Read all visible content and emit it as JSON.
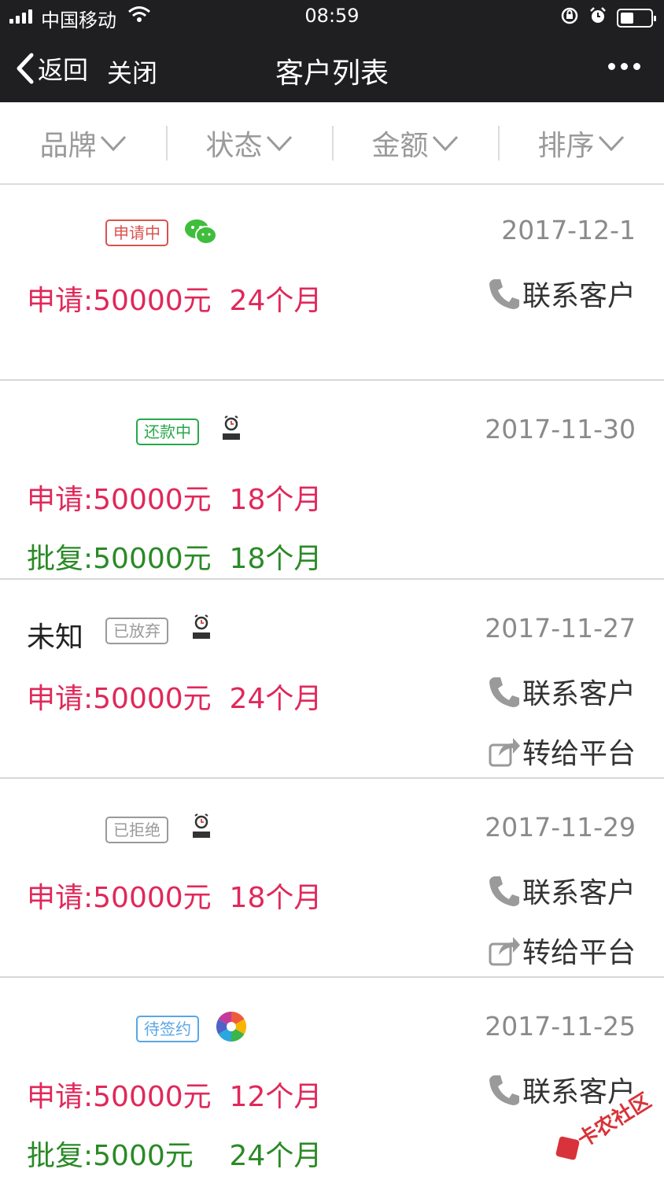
{
  "status_bar": {
    "carrier": "中国移动",
    "time": "08:59"
  },
  "nav": {
    "back_label": "返回",
    "close_label": "关闭",
    "title": "客户列表"
  },
  "filters": [
    {
      "label": "品牌"
    },
    {
      "label": "状态"
    },
    {
      "label": "金额"
    },
    {
      "label": "排序"
    }
  ],
  "customers": [
    {
      "name": "",
      "status": "申请中",
      "source_icon": "wechat-icon",
      "date": "2017-12-1",
      "apply_text": "申请:50000元  24个月",
      "approve_text": "",
      "contact_label": "联系客户",
      "transfer_label": ""
    },
    {
      "name": "",
      "status": "还款中",
      "source_icon": "alarm-app-icon",
      "date": "2017-11-30",
      "apply_text": "申请:50000元  18个月",
      "approve_text": "批复:50000元  18个月",
      "contact_label": "",
      "transfer_label": ""
    },
    {
      "name": "未知",
      "status": "已放弃",
      "source_icon": "alarm-app-icon",
      "date": "2017-11-27",
      "apply_text": "申请:50000元  24个月",
      "approve_text": "",
      "contact_label": "联系客户",
      "transfer_label": "转给平台"
    },
    {
      "name": "",
      "status": "已拒绝",
      "source_icon": "alarm-app-icon",
      "date": "2017-11-29",
      "apply_text": "申请:50000元  18个月",
      "approve_text": "",
      "contact_label": "联系客户",
      "transfer_label": "转给平台"
    },
    {
      "name": "",
      "status": "待签约",
      "source_icon": "color-wheel-icon",
      "date": "2017-11-25",
      "apply_text": "申请:50000元  12个月",
      "approve_text": "批复:5000元    24个月",
      "contact_label": "联系客户",
      "transfer_label": ""
    }
  ],
  "watermark": {
    "text": "卡农社区"
  },
  "colors": {
    "apply": "#e0285a",
    "approve": "#2a8a26",
    "nav_bg": "#1f1f22"
  }
}
